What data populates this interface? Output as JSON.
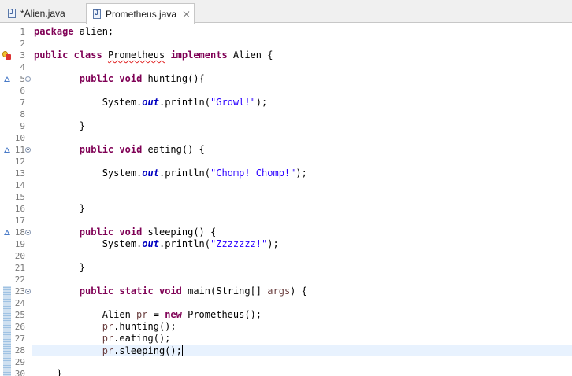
{
  "tabs": [
    {
      "label": "*Alien.java",
      "active": false
    },
    {
      "label": "Prometheus.java",
      "active": true
    }
  ],
  "editor": {
    "current_line": 28,
    "lines": [
      {
        "n": "1",
        "tokens": [
          {
            "t": "package",
            "c": "kw"
          },
          {
            "t": " alien;"
          }
        ]
      },
      {
        "n": "2",
        "tokens": []
      },
      {
        "n": "3",
        "marker": "error",
        "tokens": [
          {
            "t": "public",
            "c": "kw"
          },
          {
            "t": " "
          },
          {
            "t": "class",
            "c": "kw"
          },
          {
            "t": " "
          },
          {
            "t": "Prometheus",
            "c": "squiggle"
          },
          {
            "t": " "
          },
          {
            "t": "implements",
            "c": "kw"
          },
          {
            "t": " Alien {"
          }
        ]
      },
      {
        "n": "4",
        "tokens": []
      },
      {
        "n": "5",
        "marker": "override",
        "fold": true,
        "tokens": [
          {
            "t": "        "
          },
          {
            "t": "public",
            "c": "kw"
          },
          {
            "t": " "
          },
          {
            "t": "void",
            "c": "kw"
          },
          {
            "t": " hunting(){"
          }
        ]
      },
      {
        "n": "6",
        "tokens": []
      },
      {
        "n": "7",
        "tokens": [
          {
            "t": "            System."
          },
          {
            "t": "out",
            "c": "field"
          },
          {
            "t": ".println("
          },
          {
            "t": "\"Growl!\"",
            "c": "str"
          },
          {
            "t": ");"
          }
        ]
      },
      {
        "n": "8",
        "tokens": []
      },
      {
        "n": "9",
        "tokens": [
          {
            "t": "        }"
          }
        ]
      },
      {
        "n": "10",
        "tokens": []
      },
      {
        "n": "11",
        "marker": "override",
        "fold": true,
        "tokens": [
          {
            "t": "        "
          },
          {
            "t": "public",
            "c": "kw"
          },
          {
            "t": " "
          },
          {
            "t": "void",
            "c": "kw"
          },
          {
            "t": " eating() {"
          }
        ]
      },
      {
        "n": "12",
        "tokens": []
      },
      {
        "n": "13",
        "tokens": [
          {
            "t": "            System."
          },
          {
            "t": "out",
            "c": "field"
          },
          {
            "t": ".println("
          },
          {
            "t": "\"Chomp! Chomp!\"",
            "c": "str"
          },
          {
            "t": ");"
          }
        ]
      },
      {
        "n": "14",
        "tokens": []
      },
      {
        "n": "15",
        "tokens": []
      },
      {
        "n": "16",
        "tokens": [
          {
            "t": "        }"
          }
        ]
      },
      {
        "n": "17",
        "tokens": []
      },
      {
        "n": "18",
        "marker": "override",
        "fold": true,
        "tokens": [
          {
            "t": "        "
          },
          {
            "t": "public",
            "c": "kw"
          },
          {
            "t": " "
          },
          {
            "t": "void",
            "c": "kw"
          },
          {
            "t": " sleeping() {"
          }
        ]
      },
      {
        "n": "19",
        "tokens": [
          {
            "t": "            System."
          },
          {
            "t": "out",
            "c": "field"
          },
          {
            "t": ".println("
          },
          {
            "t": "\"Zzzzzzz!\"",
            "c": "str"
          },
          {
            "t": ");"
          }
        ]
      },
      {
        "n": "20",
        "tokens": []
      },
      {
        "n": "21",
        "tokens": [
          {
            "t": "        }"
          }
        ]
      },
      {
        "n": "22",
        "tokens": []
      },
      {
        "n": "23",
        "marker": "selected",
        "fold": true,
        "tokens": [
          {
            "t": "        "
          },
          {
            "t": "public",
            "c": "kw"
          },
          {
            "t": " "
          },
          {
            "t": "static",
            "c": "kw"
          },
          {
            "t": " "
          },
          {
            "t": "void",
            "c": "kw"
          },
          {
            "t": " main(String[] "
          },
          {
            "t": "args",
            "c": "var"
          },
          {
            "t": ") {"
          }
        ]
      },
      {
        "n": "24",
        "marker": "selected",
        "tokens": []
      },
      {
        "n": "25",
        "marker": "selected",
        "tokens": [
          {
            "t": "            Alien "
          },
          {
            "t": "pr",
            "c": "var"
          },
          {
            "t": " = "
          },
          {
            "t": "new",
            "c": "kw"
          },
          {
            "t": " Prometheus();"
          }
        ]
      },
      {
        "n": "26",
        "marker": "selected",
        "tokens": [
          {
            "t": "            "
          },
          {
            "t": "pr",
            "c": "var"
          },
          {
            "t": ".hunting();"
          }
        ]
      },
      {
        "n": "27",
        "marker": "selected",
        "tokens": [
          {
            "t": "            "
          },
          {
            "t": "pr",
            "c": "var"
          },
          {
            "t": ".eating();"
          }
        ]
      },
      {
        "n": "28",
        "marker": "selected",
        "tokens": [
          {
            "t": "            "
          },
          {
            "t": "pr",
            "c": "var"
          },
          {
            "t": ".sleeping();"
          }
        ]
      },
      {
        "n": "29",
        "marker": "selected",
        "tokens": []
      },
      {
        "n": "30",
        "marker": "selected",
        "tokens": [
          {
            "t": "    }"
          }
        ]
      }
    ]
  }
}
